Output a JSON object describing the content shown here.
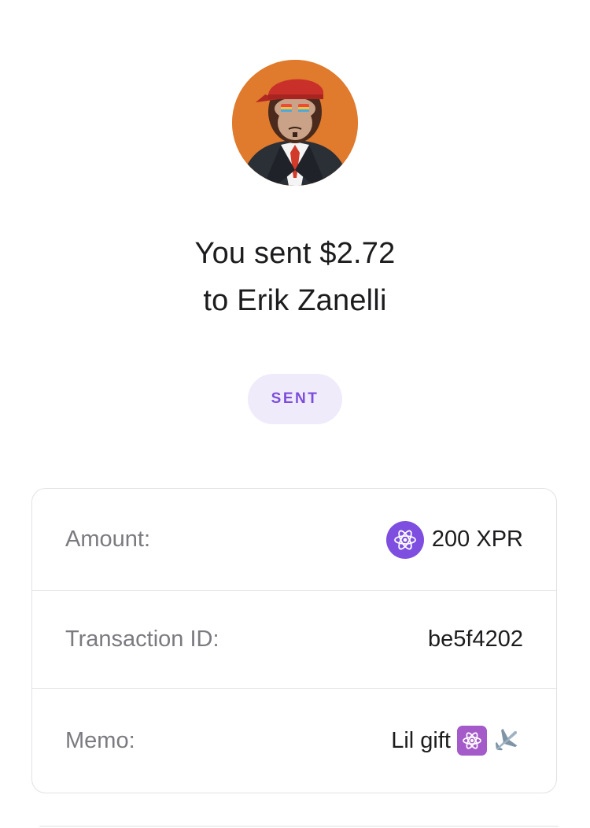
{
  "recipient": {
    "avatar_icon": "ape-avatar-icon",
    "avatar_bg": "#e07a2c"
  },
  "headline": {
    "line1": "You sent $2.72",
    "line2": "to Erik Zanelli"
  },
  "status": {
    "label": "SENT",
    "color": "#7c4ddc",
    "bg": "#efebfb"
  },
  "details": {
    "amount": {
      "label": "Amount:",
      "value": "200 XPR",
      "icon": "xpr-token-icon"
    },
    "transaction": {
      "label": "Transaction ID:",
      "value": "be5f4202"
    },
    "memo": {
      "label": "Memo:",
      "value": "Lil gift",
      "emojis": [
        "atom-emoji",
        "airplane-emoji"
      ]
    }
  }
}
